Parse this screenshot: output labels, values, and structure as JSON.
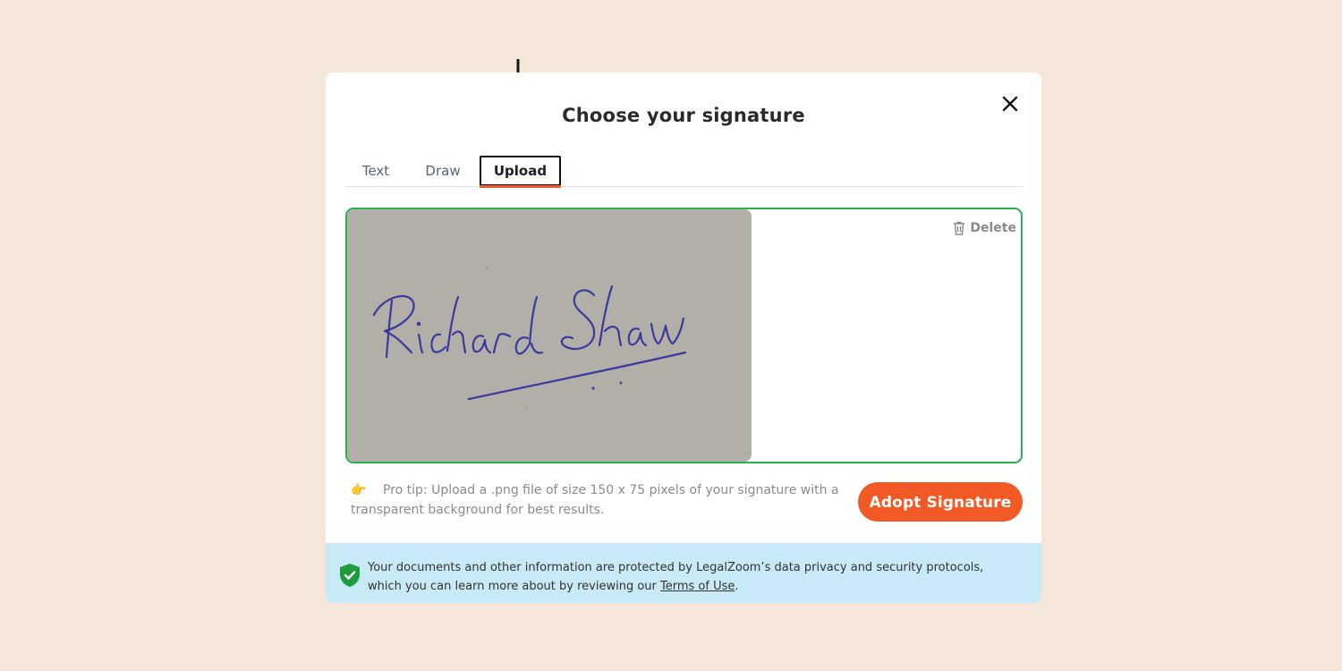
{
  "modal": {
    "title": "Choose your signature",
    "close_icon": "close-icon"
  },
  "tabs": [
    {
      "label": "Text",
      "active": false
    },
    {
      "label": "Draw",
      "active": false
    },
    {
      "label": "Upload",
      "active": true
    }
  ],
  "upload": {
    "signature_text": "Richard Shaw",
    "delete_label": "Delete",
    "delete_icon": "trash-icon"
  },
  "tip": {
    "icon": "pointing-hand-icon",
    "emoji": "👉",
    "text": "Pro tip: Upload a .png file of size 150 x 75 pixels of your signature with a transparent background for best results."
  },
  "actions": {
    "adopt_label": "Adopt Signature"
  },
  "footer": {
    "text_before": "Your documents and other information are protected by LegalZoom’s data privacy and security protocols, which you can learn more about by reviewing our ",
    "link_text": "Terms of Use",
    "text_after": ".",
    "icon": "shield-check-icon"
  },
  "colors": {
    "page_bg": "#f4e7da",
    "accent": "#f15a24",
    "success_border": "#2bb24c",
    "footer_bg": "#c8eaf7",
    "ink": "#3a3a9e"
  }
}
